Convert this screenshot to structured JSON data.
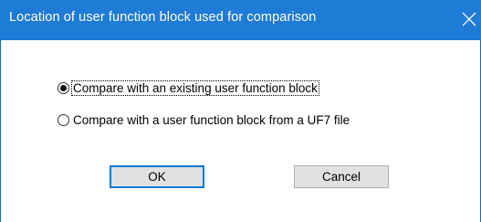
{
  "window": {
    "title": "Location of user function block used for comparison",
    "close_icon": "close-icon"
  },
  "options": [
    {
      "label": "Compare with an existing user function block",
      "selected": true
    },
    {
      "label": "Compare with a user function block from a UF7 file",
      "selected": false
    }
  ],
  "buttons": {
    "ok_label": "OK",
    "cancel_label": "Cancel"
  },
  "colors": {
    "titlebar": "#1e7bd6",
    "default_button_border": "#0078d7"
  }
}
